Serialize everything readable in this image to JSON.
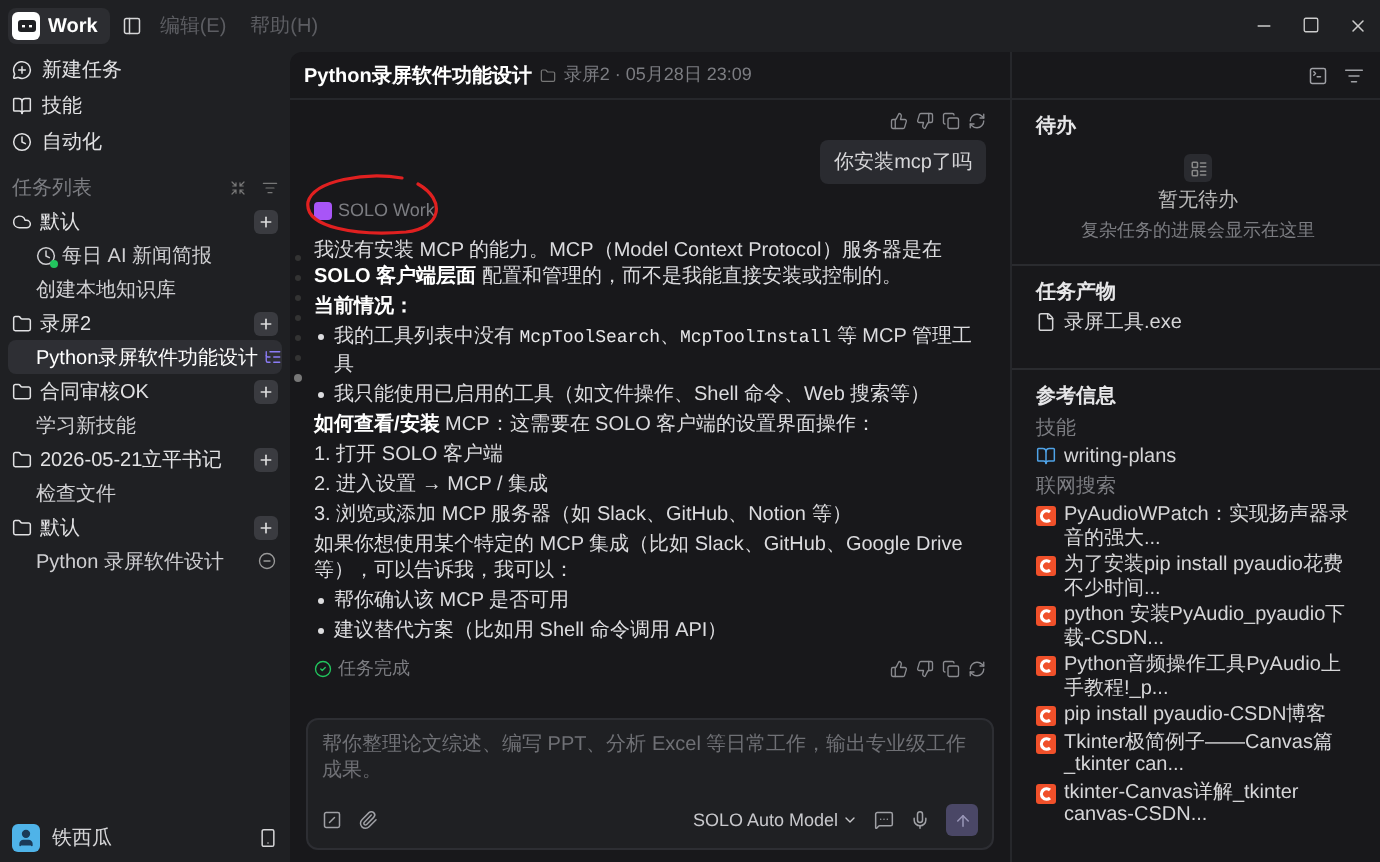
{
  "titlebar": {
    "app_label": "Work",
    "menus": [
      {
        "label": "编辑(E)",
        "disabled": true
      },
      {
        "label": "帮助(H)",
        "disabled": true
      }
    ]
  },
  "sidebar": {
    "nav": [
      {
        "label": "新建任务"
      },
      {
        "label": "技能"
      },
      {
        "label": "自动化"
      }
    ],
    "task_list_label": "任务列表",
    "groups": [
      {
        "name": "默认",
        "kind": "cloud",
        "tasks": [
          {
            "label": "每日 AI 新闻简报",
            "kind": "scheduled",
            "selected": false
          },
          {
            "label": "创建本地知识库",
            "kind": "plain",
            "selected": false
          }
        ]
      },
      {
        "name": "录屏2",
        "kind": "folder",
        "tasks": [
          {
            "label": "Python录屏软件功能设计",
            "kind": "plain",
            "selected": true
          }
        ]
      },
      {
        "name": "合同审核OK",
        "kind": "folder",
        "tasks": [
          {
            "label": "学习新技能",
            "kind": "plain",
            "selected": false
          }
        ]
      },
      {
        "name": "2026-05-21立平书记",
        "kind": "folder",
        "tasks": [
          {
            "label": "检查文件",
            "kind": "plain",
            "selected": false
          }
        ]
      },
      {
        "name": "默认",
        "kind": "folder",
        "tasks": [
          {
            "label": "Python 录屏软件设计",
            "kind": "removable",
            "selected": false
          }
        ]
      }
    ],
    "user": {
      "name": "铁西瓜"
    }
  },
  "chat": {
    "title": "Python录屏软件功能设计",
    "meta": "录屏2 · 05月28日 23:09",
    "user_message": "你安装mcp了吗",
    "assistant_name": "SOLO Work",
    "blocks": [
      {
        "kind": "paragraph",
        "text": "我没有安装 MCP 的能力。MCP（Model Context Protocol）服务器是在 **SOLO 客户端层面** 配置和管理的，而不是我能直接安装或控制的。"
      },
      {
        "kind": "heading",
        "text": "当前情况："
      },
      {
        "kind": "bullet",
        "parts": [
          {
            "kind": "text",
            "text": "我的工具列表中没有 "
          },
          {
            "kind": "code",
            "text": "McpToolSearch"
          },
          {
            "kind": "text",
            "text": "、"
          },
          {
            "kind": "code",
            "text": "McpToolInstall"
          },
          {
            "kind": "text",
            "text": " 等 MCP 管理工具"
          }
        ]
      },
      {
        "kind": "bullet",
        "parts": [
          {
            "kind": "text",
            "text": "我只能使用已启用的工具（如文件操作、Shell 命令、Web 搜索等）"
          }
        ]
      },
      {
        "kind": "paragraph",
        "text": "**如何查看/安装** MCP：这需要在 SOLO 客户端的设置界面操作："
      },
      {
        "kind": "paragraph",
        "text": "1. 打开 SOLO 客户端"
      },
      {
        "kind": "paragraph",
        "text": "2. 进入设置 → MCP / 集成"
      },
      {
        "kind": "paragraph",
        "text": "3. 浏览或添加 MCP 服务器（如 Slack、GitHub、Notion 等）"
      },
      {
        "kind": "paragraph",
        "text": "如果你想使用某个特定的 MCP 集成（比如 Slack、GitHub、Google Drive 等），可以告诉我，我可以："
      },
      {
        "kind": "bullet",
        "parts": [
          {
            "kind": "text",
            "text": "帮你确认该 MCP 是否可用"
          }
        ]
      },
      {
        "kind": "bullet",
        "parts": [
          {
            "kind": "text",
            "text": "建议替代方案（比如用 Shell 命令调用 API）"
          }
        ]
      }
    ],
    "status": "任务完成",
    "input": {
      "placeholder": "帮你整理论文综述、编写 PPT、分析 Excel 等日常工作，输出专业级工作成果。",
      "model": "SOLO Auto Model"
    }
  },
  "panel": {
    "todo": {
      "title": "待办",
      "empty_title": "暂无待办",
      "empty_hint": "复杂任务的进展会显示在这里"
    },
    "artifacts": {
      "title": "任务产物",
      "files": [
        "录屏工具.exe"
      ]
    },
    "references": {
      "title": "参考信息",
      "skills_label": "技能",
      "skills": [
        "writing-plans"
      ],
      "search_label": "联网搜索",
      "results": [
        "PyAudioWPatch：实现扬声器录音的强大...",
        "为了安装pip install pyaudio花费不少时间...",
        "python 安装PyAudio_pyaudio下载-CSDN...",
        "Python音频操作工具PyAudio上手教程!_p...",
        "pip install pyaudio-CSDN博客",
        "Tkinter极简例子——Canvas篇_tkinter can...",
        "tkinter-Canvas详解_tkinter canvas-CSDN..."
      ]
    }
  }
}
